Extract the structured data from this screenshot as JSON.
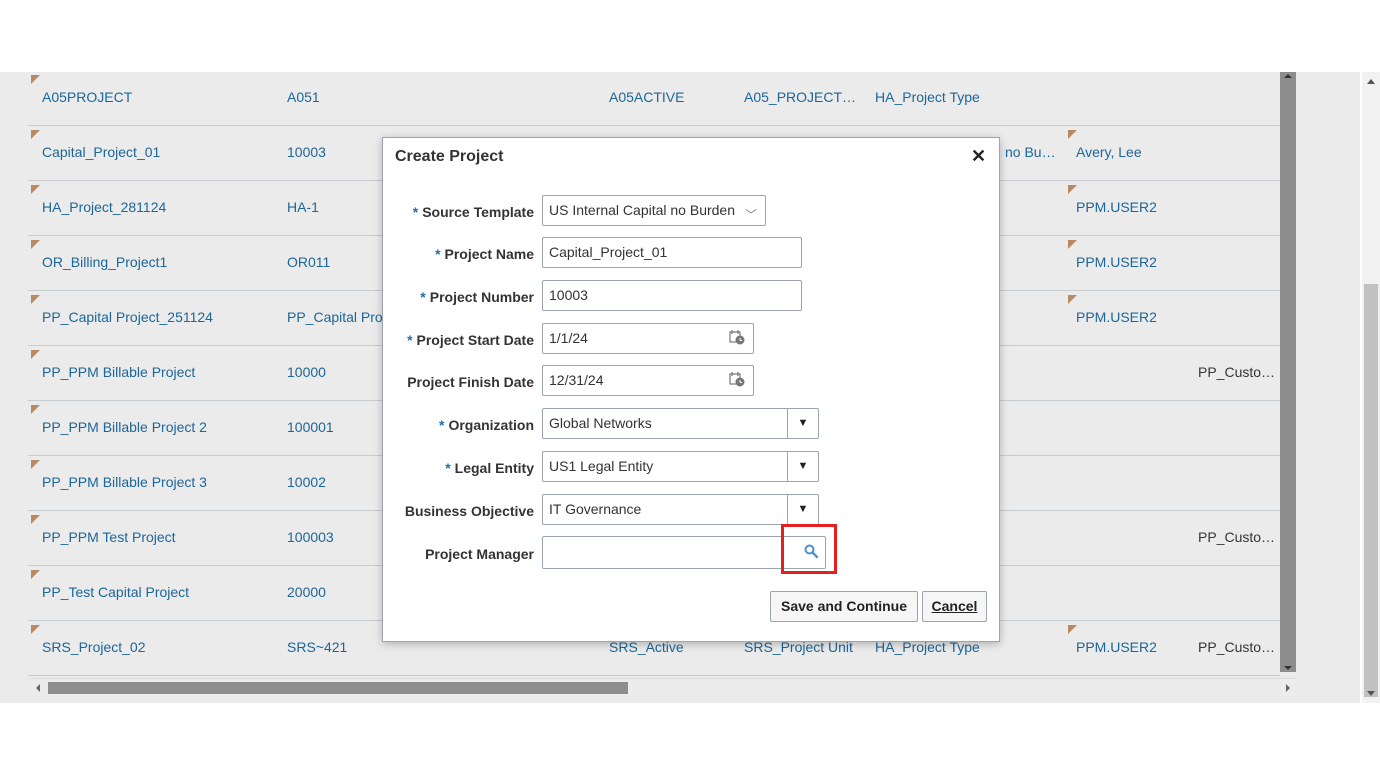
{
  "table": {
    "rows": [
      {
        "name": "A05PROJECT",
        "number": "A051",
        "status": "A05ACTIVE",
        "unit": "A05_PROJECT…",
        "type": "HA_Project Type",
        "org": "",
        "manager": "",
        "customer": ""
      },
      {
        "name": "Capital_Project_01",
        "number": "10003",
        "status": "",
        "unit": "",
        "type": "",
        "org": "no Bu…",
        "manager": "Avery, Lee",
        "customer": ""
      },
      {
        "name": "HA_Project_281124",
        "number": "HA-1",
        "status": "",
        "unit": "",
        "type": "",
        "org": "",
        "manager": "PPM.USER2",
        "customer": ""
      },
      {
        "name": "OR_Billing_Project1",
        "number": "OR011",
        "status": "",
        "unit": "",
        "type": "",
        "org": "",
        "manager": "PPM.USER2",
        "customer": ""
      },
      {
        "name": "PP_Capital Project_251124",
        "number": "PP_Capital Pro",
        "status": "",
        "unit": "",
        "type": "",
        "org": "",
        "manager": "PPM.USER2",
        "customer": ""
      },
      {
        "name": "PP_PPM Billable Project",
        "number": "10000",
        "status": "",
        "unit": "",
        "type": "",
        "org": "",
        "manager": "",
        "customer": "PP_Custome"
      },
      {
        "name": "PP_PPM Billable Project 2",
        "number": "100001",
        "status": "",
        "unit": "",
        "type": "",
        "org": "",
        "manager": "",
        "customer": ""
      },
      {
        "name": "PP_PPM Billable Project 3",
        "number": "10002",
        "status": "",
        "unit": "",
        "type": "",
        "org": "",
        "manager": "",
        "customer": ""
      },
      {
        "name": "PP_PPM Test Project",
        "number": "100003",
        "status": "",
        "unit": "",
        "type": "",
        "org": "",
        "manager": "",
        "customer": "PP_Custome"
      },
      {
        "name": "PP_Test Capital Project",
        "number": "20000",
        "status": "",
        "unit": "",
        "type": "",
        "org": "",
        "manager": "",
        "customer": ""
      },
      {
        "name": "SRS_Project_02",
        "number": "SRS~421",
        "status": "SRS_Active",
        "unit": "SRS_Project Unit",
        "type": "HA_Project Type",
        "org": "",
        "manager": "PPM.USER2",
        "customer": "PP_Custome"
      }
    ]
  },
  "dialog": {
    "title": "Create Project",
    "close_icon": "close-icon",
    "fields": {
      "source_template": {
        "label": "Source Template",
        "value": "US Internal Capital no Burden"
      },
      "project_name": {
        "label": "Project Name",
        "value": "Capital_Project_01"
      },
      "project_number": {
        "label": "Project Number",
        "value": "10003"
      },
      "project_start_date": {
        "label": "Project Start Date",
        "value": "1/1/24"
      },
      "project_finish_date": {
        "label": "Project Finish Date",
        "value": "12/31/24"
      },
      "organization": {
        "label": "Organization",
        "value": "Global Networks"
      },
      "legal_entity": {
        "label": "Legal Entity",
        "value": "US1 Legal Entity"
      },
      "business_objective": {
        "label": "Business Objective",
        "value": "IT Governance"
      },
      "project_manager": {
        "label": "Project Manager",
        "value": ""
      }
    },
    "required_marker": "*",
    "buttons": {
      "save_continue": "Save and Continue",
      "cancel": "Cancel"
    }
  },
  "colors": {
    "link": "#1f6fa6",
    "highlight": "#e51f1f",
    "flag": "#c8956b"
  }
}
